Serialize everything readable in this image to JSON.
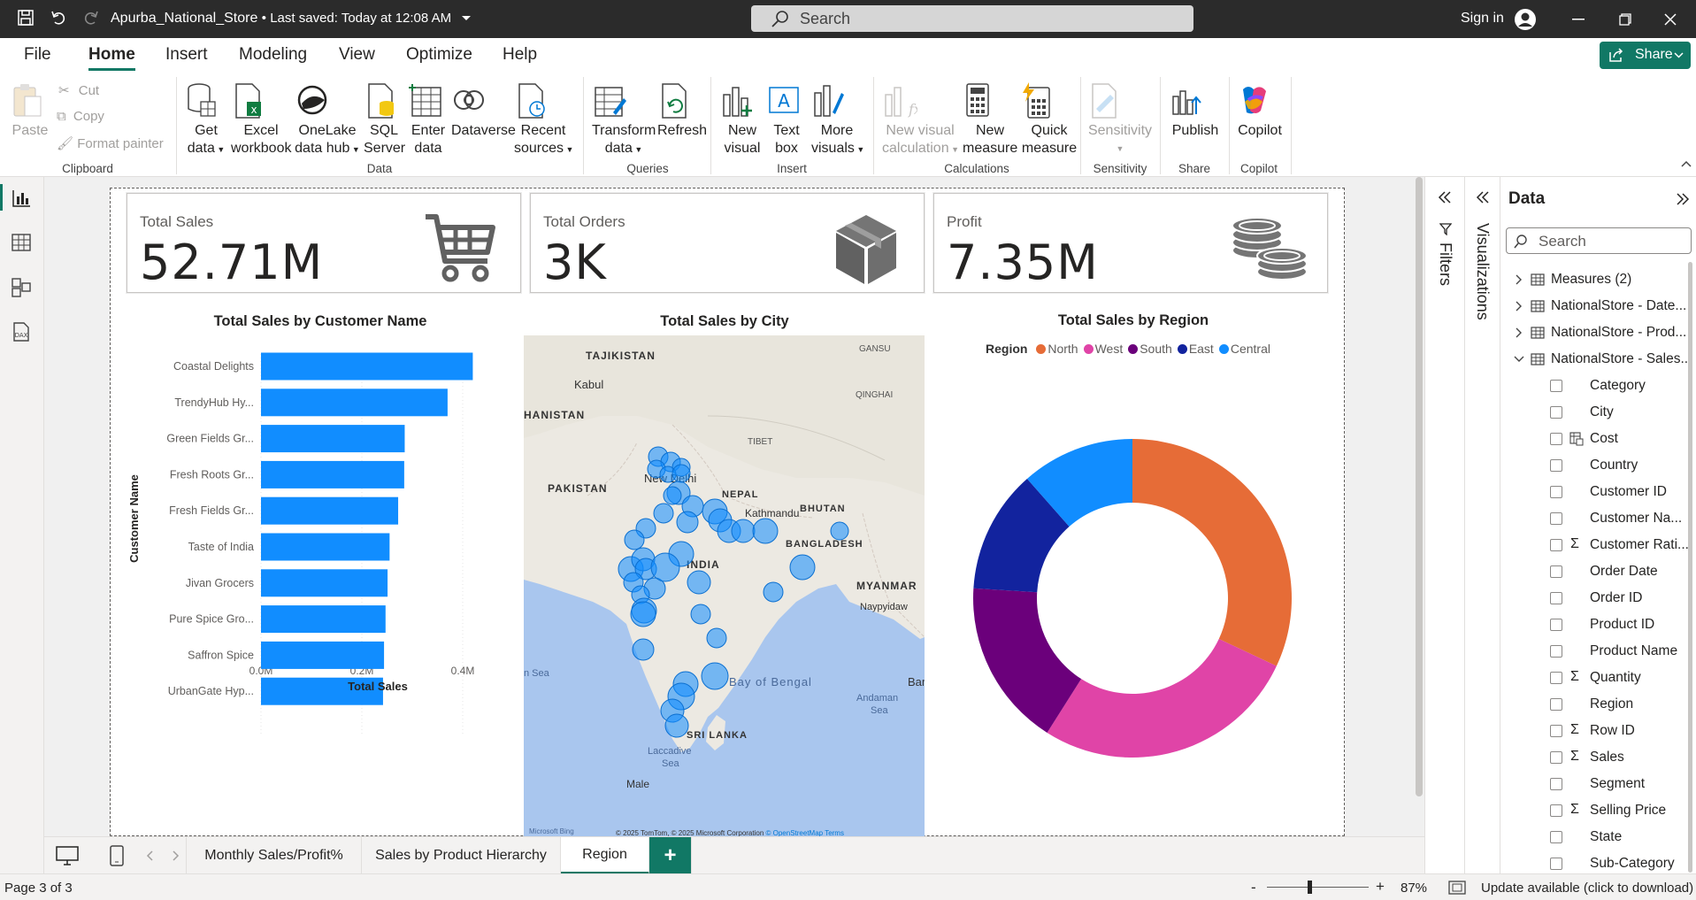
{
  "app": {
    "file_name": "Apurba_National_Store",
    "save_status": "• Last saved: Today at 12:08 AM",
    "search_placeholder": "Search",
    "sign_in": "Sign in"
  },
  "menu": [
    "File",
    "Home",
    "Insert",
    "Modeling",
    "View",
    "Optimize",
    "Help"
  ],
  "active_menu": "Home",
  "share_label": "Share",
  "ribbon": {
    "clipboard": {
      "paste": "Paste",
      "cut": "Cut",
      "copy": "Copy",
      "format_painter": "Format painter",
      "group": "Clipboard"
    },
    "data": {
      "get_data": [
        "Get",
        "data"
      ],
      "excel": [
        "Excel",
        "workbook"
      ],
      "onelake": [
        "OneLake",
        "data hub"
      ],
      "sql": [
        "SQL",
        "Server"
      ],
      "enter": [
        "Enter",
        "data"
      ],
      "dataverse": "Dataverse",
      "recent": [
        "Recent",
        "sources"
      ],
      "group": "Data"
    },
    "queries": {
      "transform": [
        "Transform",
        "data"
      ],
      "refresh": "Refresh",
      "group": "Queries"
    },
    "insert": {
      "new_visual": [
        "New",
        "visual"
      ],
      "text_box": [
        "Text",
        "box"
      ],
      "more": [
        "More",
        "visuals"
      ],
      "group": "Insert"
    },
    "calculations": {
      "new_visual_calc": [
        "New visual",
        "calculation"
      ],
      "new_measure": [
        "New",
        "measure"
      ],
      "quick_measure": [
        "Quick",
        "measure"
      ],
      "group": "Calculations"
    },
    "sensitivity": {
      "label": "Sensitivity",
      "group": "Sensitivity"
    },
    "share": {
      "publish": "Publish",
      "group": "Share"
    },
    "copilot": {
      "label": "Copilot",
      "group": "Copilot"
    }
  },
  "cards": [
    {
      "label": "Total Sales",
      "value": "52.71M",
      "icon": "shopping-cart-icon"
    },
    {
      "label": "Total Orders",
      "value": "3K",
      "icon": "package-box-icon"
    },
    {
      "label": "Profit",
      "value": "7.35M",
      "icon": "coins-icon"
    }
  ],
  "bar_chart": {
    "title": "Total Sales by Customer Name",
    "ylabel": "Customer Name",
    "xlabel": "Total Sales",
    "ticks": [
      "0.0M",
      "0.2M",
      "0.4M"
    ]
  },
  "map": {
    "title": "Total Sales by City",
    "labels": {
      "tajikistan": "TAJIKISTAN",
      "gansu": "GANSU",
      "kabul": "Kabul",
      "qinghai": "QINGHAI",
      "hanistan": "HANISTAN",
      "tibet": "TIBET",
      "new_delhi": "New Delhi",
      "pakistan": "PAKISTAN",
      "nepal": "NEPAL",
      "kathmandu": "Kathmandu",
      "bhutan": "BHUTAN",
      "bangladesh": "BANGLADESH",
      "india": "INDIA",
      "myanmar": "MYANMAR",
      "naypyidaw": "Naypyidaw",
      "arabian_sea": "n Sea",
      "bay_of_bengal": "Bay of Bengal",
      "bar": "Bar",
      "andaman": "Andaman",
      "andaman_sea": "Sea",
      "sri_lanka": "SRI LANKA",
      "laccadive": "Laccadive",
      "laccadive_sea": "Sea",
      "male": "Male"
    },
    "bing": "Microsoft Bing",
    "copyright": "© 2025 TomTom, © 2025 Microsoft Corporation",
    "osm": "© OpenStreetMap",
    "terms": "Terms"
  },
  "donut": {
    "title": "Total Sales by Region",
    "legend_title": "Region"
  },
  "chart_data": [
    {
      "type": "bar",
      "title": "Total Sales by Customer Name",
      "xlabel": "Total Sales",
      "ylabel": "Customer Name",
      "categories": [
        "Coastal Delights",
        "TrendyHub Hy...",
        "Green Fields Gr...",
        "Fresh Roots Gr...",
        "Fresh Fields Gr...",
        "Taste of India",
        "Jivan Grocers",
        "Pure Spice Gro...",
        "Saffron Spice",
        "UrbanGate Hyp..."
      ],
      "values": [
        0.42,
        0.37,
        0.285,
        0.284,
        0.272,
        0.255,
        0.251,
        0.247,
        0.244,
        0.242
      ],
      "unit": "M",
      "xlim": [
        0,
        0.4
      ],
      "color": "#118DFF",
      "grid": true
    },
    {
      "type": "pie",
      "title": "Total Sales by Region",
      "categories": [
        "North",
        "West",
        "South",
        "East",
        "Central"
      ],
      "values": [
        32,
        27,
        17,
        12.5,
        11.5
      ],
      "colors": [
        "#E66C37",
        "#E044A7",
        "#6B007B",
        "#12239E",
        "#118DFF"
      ],
      "legend": "top",
      "donut": true
    },
    {
      "type": "scatter",
      "title": "Total Sales by City",
      "note": "bubble map of Indian cities",
      "points": [
        [
          744,
          516,
          11
        ],
        [
          758,
          522,
          11
        ],
        [
          770,
          528,
          10
        ],
        [
          742,
          530,
          10
        ],
        [
          755,
          536,
          9
        ],
        [
          770,
          535,
          10
        ],
        [
          767,
          557,
          13
        ],
        [
          760,
          560,
          10
        ],
        [
          783,
          572,
          12
        ],
        [
          777,
          590,
          12
        ],
        [
          808,
          578,
          14
        ],
        [
          814,
          588,
          13
        ],
        [
          824,
          600,
          13
        ],
        [
          840,
          600,
          13
        ],
        [
          865,
          600,
          14
        ],
        [
          730,
          597,
          11
        ],
        [
          750,
          580,
          11
        ],
        [
          717,
          610,
          11
        ],
        [
          713,
          643,
          14
        ],
        [
          727,
          632,
          13
        ],
        [
          730,
          643,
          12
        ],
        [
          740,
          665,
          12
        ],
        [
          770,
          626,
          14
        ],
        [
          752,
          641,
          16
        ],
        [
          790,
          658,
          13
        ],
        [
          716,
          658,
          11
        ],
        [
          724,
          672,
          10
        ],
        [
          728,
          690,
          14
        ],
        [
          727,
          694,
          14
        ],
        [
          907,
          641,
          14
        ],
        [
          874,
          669,
          11
        ],
        [
          792,
          694,
          11
        ],
        [
          810,
          721,
          11
        ],
        [
          727,
          734,
          12
        ],
        [
          808,
          764,
          15
        ],
        [
          775,
          773,
          14
        ],
        [
          770,
          787,
          15
        ],
        [
          760,
          803,
          13
        ],
        [
          765,
          820,
          13
        ],
        [
          949,
          600,
          10
        ]
      ],
      "color": "#118DFF"
    }
  ],
  "panes": {
    "filters": "Filters",
    "visualizations": "Visualizations",
    "data_title": "Data",
    "data_search": "Search",
    "tables": [
      {
        "name": "Measures (2)",
        "expanded": false
      },
      {
        "name": "NationalStore - Date...",
        "expanded": false
      },
      {
        "name": "NationalStore - Prod...",
        "expanded": false
      },
      {
        "name": "NationalStore - Sales...",
        "expanded": true
      }
    ],
    "fields": [
      {
        "name": "Category",
        "sigma": false
      },
      {
        "name": "City",
        "sigma": false
      },
      {
        "name": "Cost",
        "sigma": false,
        "calc": true
      },
      {
        "name": "Country",
        "sigma": false
      },
      {
        "name": "Customer ID",
        "sigma": false
      },
      {
        "name": "Customer Na...",
        "sigma": false
      },
      {
        "name": "Customer Rati...",
        "sigma": true
      },
      {
        "name": "Order Date",
        "sigma": false
      },
      {
        "name": "Order ID",
        "sigma": false
      },
      {
        "name": "Product ID",
        "sigma": false
      },
      {
        "name": "Product Name",
        "sigma": false
      },
      {
        "name": "Quantity",
        "sigma": true
      },
      {
        "name": "Region",
        "sigma": false
      },
      {
        "name": "Row ID",
        "sigma": true
      },
      {
        "name": "Sales",
        "sigma": true
      },
      {
        "name": "Segment",
        "sigma": false
      },
      {
        "name": "Selling Price",
        "sigma": true
      },
      {
        "name": "State",
        "sigma": false
      },
      {
        "name": "Sub-Category",
        "sigma": false
      }
    ]
  },
  "tabs": [
    "Monthly Sales/Profit%",
    "Sales by Product Hierarchy",
    "Region"
  ],
  "active_tab": "Region",
  "add_tab": "+",
  "status": {
    "page": "Page 3 of 3",
    "minus": "-",
    "plus": "+",
    "zoom": "87%",
    "update": "Update available (click to download)"
  }
}
